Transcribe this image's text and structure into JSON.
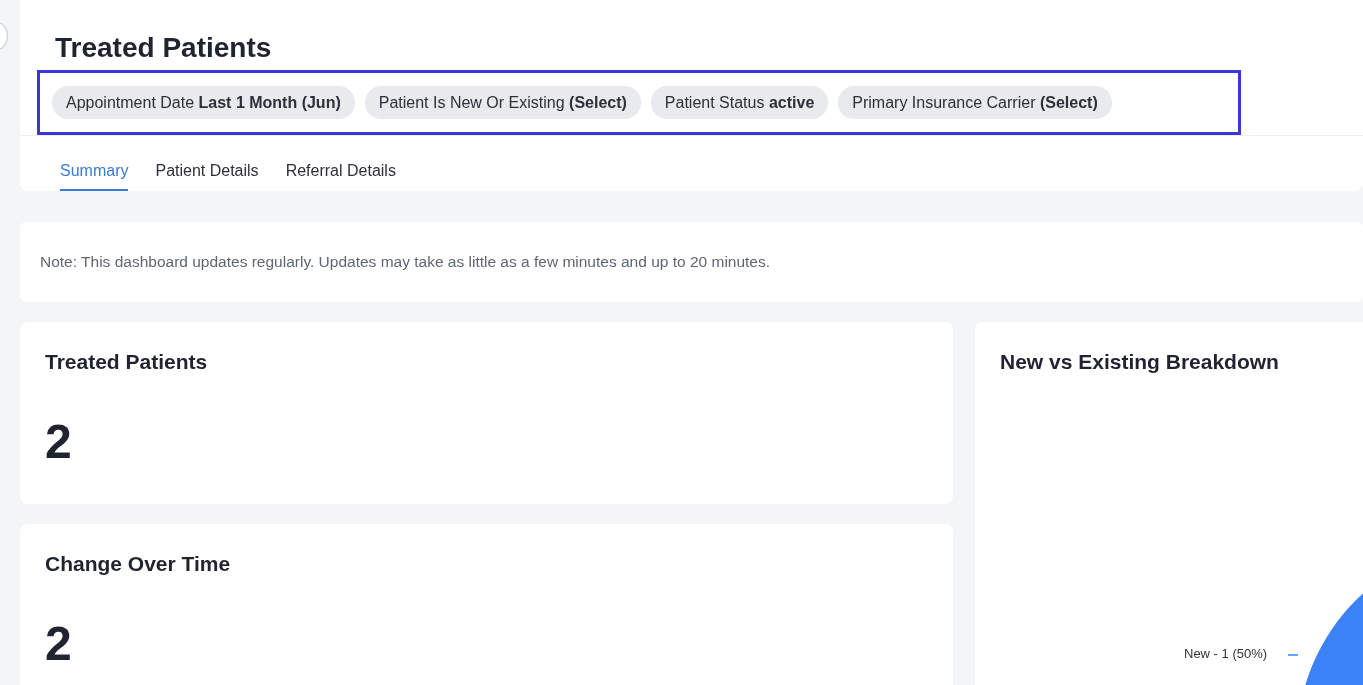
{
  "header": {
    "title": "Treated Patients"
  },
  "filters": [
    {
      "label": "Appointment Date",
      "value": "Last 1 Month (Jun)"
    },
    {
      "label": "Patient Is New Or Existing",
      "value": "(Select)"
    },
    {
      "label": "Patient Status",
      "value": "active"
    },
    {
      "label": "Primary Insurance Carrier",
      "value": "(Select)"
    }
  ],
  "tabs": [
    {
      "label": "Summary",
      "selected": true
    },
    {
      "label": "Patient Details",
      "selected": false
    },
    {
      "label": "Referral Details",
      "selected": false
    }
  ],
  "note": "Note: This dashboard updates regularly. Updates may take as little as a few minutes and up to 20 minutes.",
  "cards": [
    {
      "title": "Treated Patients",
      "value": "2"
    },
    {
      "title": "Change Over Time",
      "value": "2"
    }
  ],
  "breakdown": {
    "title": "New vs Existing Breakdown",
    "slice_label": "New - 1 (50%)"
  }
}
